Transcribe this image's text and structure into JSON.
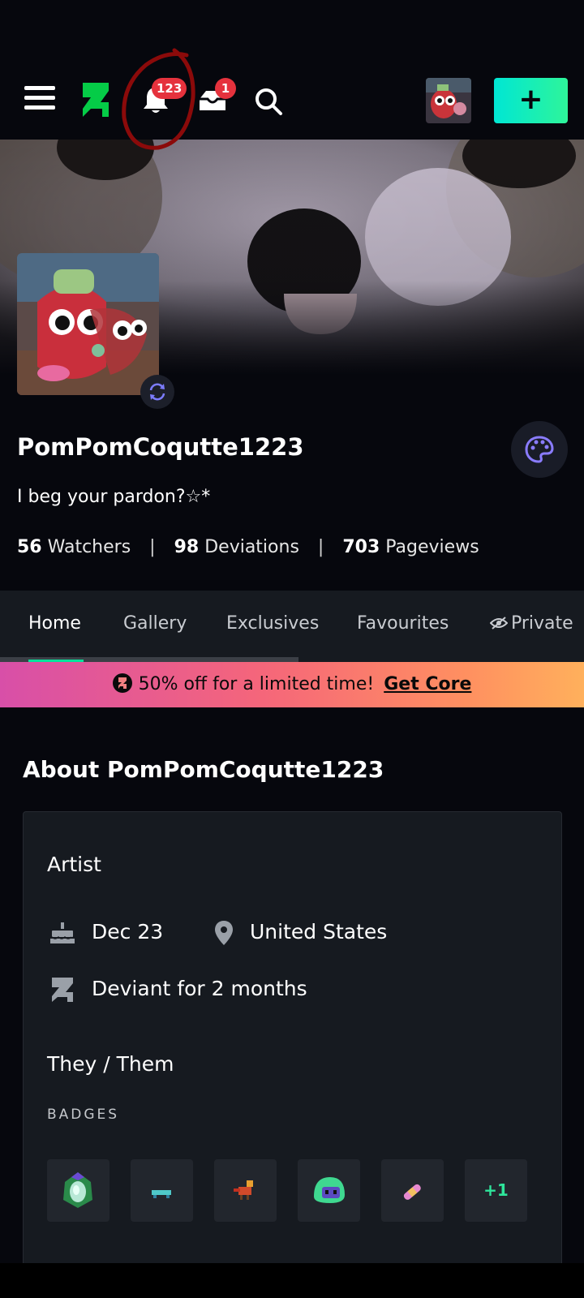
{
  "header": {
    "notification_count": "123",
    "inbox_count": "1",
    "submit_label": "+"
  },
  "profile": {
    "username": "PomPomCoqutte1223",
    "tagline": "I beg your pardon?☆*",
    "stats": [
      {
        "value": "56",
        "label": "Watchers"
      },
      {
        "value": "98",
        "label": "Deviations"
      },
      {
        "value": "703",
        "label": "Pageviews"
      }
    ],
    "stat_separator": "|"
  },
  "tabs": [
    "Home",
    "Gallery",
    "Exclusives",
    "Favourites",
    "Private"
  ],
  "promo": {
    "text": "50% off for a limited time!",
    "link": "Get Core"
  },
  "about": {
    "title": "About PomPomCoqutte1223",
    "role": "Artist",
    "birthday": "Dec 23",
    "location": "United States",
    "deviant_for": "Deviant for 2 months",
    "pronouns": "They / Them",
    "badges_label": "BADGES",
    "badges_more": "+1"
  },
  "colors": {
    "accent": "#00e59b",
    "notification_badge": "#e5323d",
    "annotation": "#8b0a0a"
  }
}
